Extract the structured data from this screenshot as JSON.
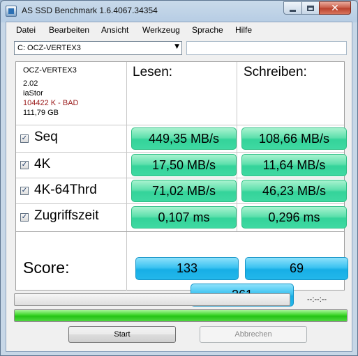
{
  "window": {
    "title": "AS SSD Benchmark 1.6.4067.34354"
  },
  "menu": [
    "Datei",
    "Bearbeiten",
    "Ansicht",
    "Werkzeug",
    "Sprache",
    "Hilfe"
  ],
  "drive_select": {
    "value": "C: OCZ-VERTEX3"
  },
  "drive_info": {
    "model": "OCZ-VERTEX3",
    "firmware": "2.02",
    "driver": "iaStor",
    "alignment": "104422 K - BAD",
    "size": "111,79 GB",
    "alignment_color": "#9b1c1c"
  },
  "columns": {
    "read": "Lesen:",
    "write": "Schreiben:"
  },
  "rows": [
    {
      "label": "Seq",
      "checked": true,
      "read": "449,35 MB/s",
      "write": "108,66 MB/s"
    },
    {
      "label": "4K",
      "checked": true,
      "read": "17,50 MB/s",
      "write": "11,64 MB/s"
    },
    {
      "label": "4K-64Thrd",
      "checked": true,
      "read": "71,02 MB/s",
      "write": "46,23 MB/s"
    },
    {
      "label": "Zugriffszeit",
      "checked": true,
      "read": "0,107 ms",
      "write": "0,296 ms"
    }
  ],
  "score": {
    "label": "Score:",
    "read": "133",
    "write": "69",
    "total": "261"
  },
  "progress": {
    "time": "--:--:--",
    "current_fraction": 0,
    "total_fraction": 1
  },
  "buttons": {
    "start": "Start",
    "cancel": "Abbrechen"
  },
  "colors": {
    "result_green": "#3fd9a2",
    "score_blue": "#23b7ea",
    "progress_green": "#25c316"
  },
  "icons": {
    "checkbox": "checkmark-icon",
    "dropdown": "chevron-down-icon",
    "close": "close-icon"
  }
}
